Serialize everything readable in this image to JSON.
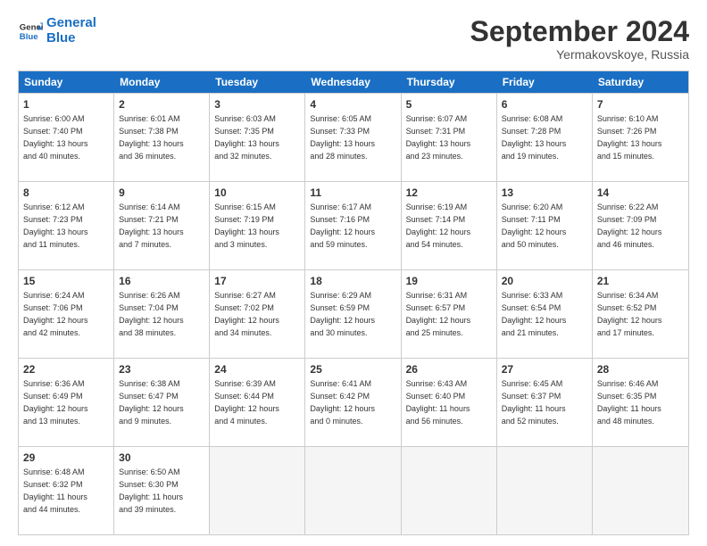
{
  "logo": {
    "line1": "General",
    "line2": "Blue"
  },
  "title": "September 2024",
  "location": "Yermakovskoye, Russia",
  "days_of_week": [
    "Sunday",
    "Monday",
    "Tuesday",
    "Wednesday",
    "Thursday",
    "Friday",
    "Saturday"
  ],
  "weeks": [
    [
      {
        "day": "1",
        "info": "Sunrise: 6:00 AM\nSunset: 7:40 PM\nDaylight: 13 hours\nand 40 minutes."
      },
      {
        "day": "2",
        "info": "Sunrise: 6:01 AM\nSunset: 7:38 PM\nDaylight: 13 hours\nand 36 minutes."
      },
      {
        "day": "3",
        "info": "Sunrise: 6:03 AM\nSunset: 7:35 PM\nDaylight: 13 hours\nand 32 minutes."
      },
      {
        "day": "4",
        "info": "Sunrise: 6:05 AM\nSunset: 7:33 PM\nDaylight: 13 hours\nand 28 minutes."
      },
      {
        "day": "5",
        "info": "Sunrise: 6:07 AM\nSunset: 7:31 PM\nDaylight: 13 hours\nand 23 minutes."
      },
      {
        "day": "6",
        "info": "Sunrise: 6:08 AM\nSunset: 7:28 PM\nDaylight: 13 hours\nand 19 minutes."
      },
      {
        "day": "7",
        "info": "Sunrise: 6:10 AM\nSunset: 7:26 PM\nDaylight: 13 hours\nand 15 minutes."
      }
    ],
    [
      {
        "day": "8",
        "info": "Sunrise: 6:12 AM\nSunset: 7:23 PM\nDaylight: 13 hours\nand 11 minutes."
      },
      {
        "day": "9",
        "info": "Sunrise: 6:14 AM\nSunset: 7:21 PM\nDaylight: 13 hours\nand 7 minutes."
      },
      {
        "day": "10",
        "info": "Sunrise: 6:15 AM\nSunset: 7:19 PM\nDaylight: 13 hours\nand 3 minutes."
      },
      {
        "day": "11",
        "info": "Sunrise: 6:17 AM\nSunset: 7:16 PM\nDaylight: 12 hours\nand 59 minutes."
      },
      {
        "day": "12",
        "info": "Sunrise: 6:19 AM\nSunset: 7:14 PM\nDaylight: 12 hours\nand 54 minutes."
      },
      {
        "day": "13",
        "info": "Sunrise: 6:20 AM\nSunset: 7:11 PM\nDaylight: 12 hours\nand 50 minutes."
      },
      {
        "day": "14",
        "info": "Sunrise: 6:22 AM\nSunset: 7:09 PM\nDaylight: 12 hours\nand 46 minutes."
      }
    ],
    [
      {
        "day": "15",
        "info": "Sunrise: 6:24 AM\nSunset: 7:06 PM\nDaylight: 12 hours\nand 42 minutes."
      },
      {
        "day": "16",
        "info": "Sunrise: 6:26 AM\nSunset: 7:04 PM\nDaylight: 12 hours\nand 38 minutes."
      },
      {
        "day": "17",
        "info": "Sunrise: 6:27 AM\nSunset: 7:02 PM\nDaylight: 12 hours\nand 34 minutes."
      },
      {
        "day": "18",
        "info": "Sunrise: 6:29 AM\nSunset: 6:59 PM\nDaylight: 12 hours\nand 30 minutes."
      },
      {
        "day": "19",
        "info": "Sunrise: 6:31 AM\nSunset: 6:57 PM\nDaylight: 12 hours\nand 25 minutes."
      },
      {
        "day": "20",
        "info": "Sunrise: 6:33 AM\nSunset: 6:54 PM\nDaylight: 12 hours\nand 21 minutes."
      },
      {
        "day": "21",
        "info": "Sunrise: 6:34 AM\nSunset: 6:52 PM\nDaylight: 12 hours\nand 17 minutes."
      }
    ],
    [
      {
        "day": "22",
        "info": "Sunrise: 6:36 AM\nSunset: 6:49 PM\nDaylight: 12 hours\nand 13 minutes."
      },
      {
        "day": "23",
        "info": "Sunrise: 6:38 AM\nSunset: 6:47 PM\nDaylight: 12 hours\nand 9 minutes."
      },
      {
        "day": "24",
        "info": "Sunrise: 6:39 AM\nSunset: 6:44 PM\nDaylight: 12 hours\nand 4 minutes."
      },
      {
        "day": "25",
        "info": "Sunrise: 6:41 AM\nSunset: 6:42 PM\nDaylight: 12 hours\nand 0 minutes."
      },
      {
        "day": "26",
        "info": "Sunrise: 6:43 AM\nSunset: 6:40 PM\nDaylight: 11 hours\nand 56 minutes."
      },
      {
        "day": "27",
        "info": "Sunrise: 6:45 AM\nSunset: 6:37 PM\nDaylight: 11 hours\nand 52 minutes."
      },
      {
        "day": "28",
        "info": "Sunrise: 6:46 AM\nSunset: 6:35 PM\nDaylight: 11 hours\nand 48 minutes."
      }
    ],
    [
      {
        "day": "29",
        "info": "Sunrise: 6:48 AM\nSunset: 6:32 PM\nDaylight: 11 hours\nand 44 minutes."
      },
      {
        "day": "30",
        "info": "Sunrise: 6:50 AM\nSunset: 6:30 PM\nDaylight: 11 hours\nand 39 minutes."
      },
      {
        "day": "",
        "info": ""
      },
      {
        "day": "",
        "info": ""
      },
      {
        "day": "",
        "info": ""
      },
      {
        "day": "",
        "info": ""
      },
      {
        "day": "",
        "info": ""
      }
    ]
  ]
}
